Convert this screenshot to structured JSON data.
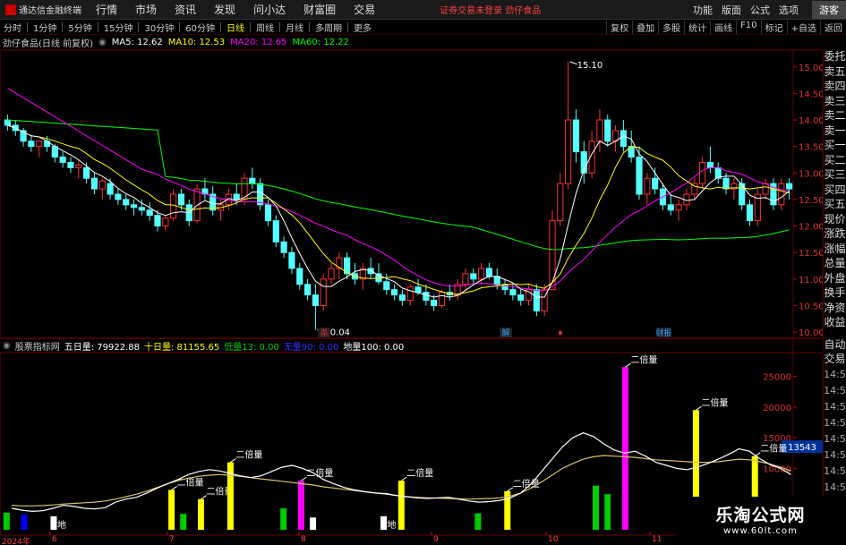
{
  "menubar": {
    "logo": "通达信金融终端",
    "items": [
      "行情",
      "市场",
      "资讯",
      "发现",
      "问小达",
      "财富圈",
      "交易"
    ],
    "alert": "证券交易未登录  劲仔食品",
    "right": [
      "功能",
      "版面",
      "公式",
      "选项"
    ],
    "guest": "游客"
  },
  "periodbar": {
    "items": [
      "分时",
      "1分钟",
      "5分钟",
      "15分钟",
      "30分钟",
      "60分钟",
      "日线",
      "周线",
      "月线",
      "多周期",
      "更多"
    ],
    "active": "日线",
    "tools": [
      "复权",
      "叠加",
      "多股",
      "统计",
      "画线",
      "F10",
      "标记",
      "+自选",
      "返回"
    ]
  },
  "infobar": {
    "stock": "劲仔食品(日线 前复权)",
    "ma5": "MA5: 12.62",
    "ma10": "MA10: 12.53",
    "ma20": "MA20: 12.65",
    "ma60": "MA60: 12.22",
    "colors": {
      "ma5": "#ffffff",
      "ma10": "#ffff00",
      "ma20": "#ff00ff",
      "ma60": "#00ff00"
    }
  },
  "annotations": {
    "high": "15.10",
    "low": "10.04",
    "double_vol": "二倍量",
    "low_vol_tag": "地"
  },
  "event_tags": [
    "杀",
    "解",
    "财报"
  ],
  "indbar": {
    "name": "股票指标网",
    "ma5": "五日量: 79922.88",
    "ma10": "十日量: 81155.65",
    "low": "低量13: 0.00",
    "zero": "无量90: 0.00",
    "ground": "地量100: 0.00"
  },
  "price_axis": [
    "15.00",
    "14.50",
    "14.00",
    "13.50",
    "13.00",
    "12.50",
    "12.00",
    "11.50",
    "11.00",
    "10.50",
    "10.00"
  ],
  "vol_axis": [
    "25000",
    "20000",
    "15000",
    "10000"
  ],
  "vol_current": "13543",
  "right_panel_top": [
    "委托",
    "卖五",
    "卖四",
    "卖三",
    "卖二",
    "卖一",
    "买一",
    "买二",
    "买三",
    "买四",
    "买五",
    "现价",
    "涨跌",
    "涨幅",
    "总量",
    "外盘",
    "换手",
    "净资",
    "收益"
  ],
  "right_panel_bottom": [
    "自动",
    "交易",
    "14:5",
    "14:5",
    "14:5",
    "14:5",
    "14:5",
    "14:5",
    "14:5",
    "14:5"
  ],
  "date_axis": [
    "2024年",
    "6",
    "7",
    "8",
    "9",
    "10",
    "11"
  ],
  "watermark": {
    "line1": "乐淘公式网",
    "line2": "www.60lt.com"
  },
  "chart_data": [
    {
      "type": "candlestick",
      "title": "劲仔食品(日线 前复权)",
      "ylim": [
        9.9,
        15.3
      ],
      "ohlc": [
        [
          14.0,
          14.1,
          13.8,
          13.9
        ],
        [
          13.9,
          14.0,
          13.7,
          13.8
        ],
        [
          13.8,
          13.85,
          13.5,
          13.6
        ],
        [
          13.6,
          13.7,
          13.4,
          13.5
        ],
        [
          13.5,
          13.6,
          13.3,
          13.6
        ],
        [
          13.6,
          13.7,
          13.4,
          13.5
        ],
        [
          13.5,
          13.55,
          13.2,
          13.3
        ],
        [
          13.3,
          13.4,
          13.1,
          13.2
        ],
        [
          13.2,
          13.3,
          13.0,
          13.1
        ],
        [
          13.1,
          13.25,
          12.9,
          13.15
        ],
        [
          13.1,
          13.2,
          12.8,
          12.9
        ],
        [
          12.9,
          13.0,
          12.6,
          12.7
        ],
        [
          12.7,
          12.9,
          12.5,
          12.85
        ],
        [
          12.8,
          12.9,
          12.5,
          12.6
        ],
        [
          12.6,
          12.7,
          12.4,
          12.5
        ],
        [
          12.5,
          12.6,
          12.3,
          12.4
        ],
        [
          12.4,
          12.5,
          12.2,
          12.35
        ],
        [
          12.35,
          12.5,
          12.2,
          12.3
        ],
        [
          12.3,
          12.45,
          12.1,
          12.2
        ],
        [
          12.2,
          12.3,
          11.9,
          12.0
        ],
        [
          12.0,
          12.2,
          11.9,
          12.15
        ],
        [
          12.15,
          12.7,
          12.1,
          12.6
        ],
        [
          12.6,
          12.7,
          12.3,
          12.4
        ],
        [
          12.4,
          12.5,
          12.0,
          12.1
        ],
        [
          12.1,
          12.8,
          12.05,
          12.7
        ],
        [
          12.7,
          12.9,
          12.5,
          12.6
        ],
        [
          12.6,
          12.75,
          12.2,
          12.3
        ],
        [
          12.3,
          12.5,
          12.1,
          12.4
        ],
        [
          12.4,
          12.7,
          12.3,
          12.6
        ],
        [
          12.6,
          12.8,
          12.4,
          12.5
        ],
        [
          12.5,
          13.0,
          12.4,
          12.9
        ],
        [
          12.9,
          13.1,
          12.7,
          12.8
        ],
        [
          12.8,
          12.9,
          12.3,
          12.4
        ],
        [
          12.4,
          12.5,
          12.0,
          12.1
        ],
        [
          12.1,
          12.2,
          11.6,
          11.7
        ],
        [
          11.7,
          11.8,
          11.4,
          11.5
        ],
        [
          11.5,
          11.6,
          11.1,
          11.2
        ],
        [
          11.2,
          11.3,
          10.8,
          10.9
        ],
        [
          10.9,
          11.0,
          10.6,
          10.7
        ],
        [
          10.7,
          10.9,
          10.04,
          10.5
        ],
        [
          10.5,
          11.1,
          10.4,
          11.0
        ],
        [
          11.0,
          11.3,
          10.9,
          11.2
        ],
        [
          11.2,
          11.5,
          11.0,
          11.4
        ],
        [
          11.4,
          11.5,
          11.0,
          11.1
        ],
        [
          11.1,
          11.3,
          10.9,
          11.0
        ],
        [
          11.0,
          11.3,
          10.8,
          11.2
        ],
        [
          11.2,
          11.4,
          11.0,
          11.1
        ],
        [
          11.1,
          11.3,
          10.9,
          10.95
        ],
        [
          10.95,
          11.1,
          10.7,
          10.8
        ],
        [
          10.8,
          10.9,
          10.6,
          10.7
        ],
        [
          10.7,
          10.8,
          10.5,
          10.6
        ],
        [
          10.6,
          10.9,
          10.5,
          10.85
        ],
        [
          10.85,
          11.0,
          10.7,
          10.75
        ],
        [
          10.75,
          10.9,
          10.5,
          10.6
        ],
        [
          10.6,
          10.7,
          10.4,
          10.5
        ],
        [
          10.5,
          10.8,
          10.45,
          10.75
        ],
        [
          10.75,
          10.9,
          10.6,
          10.7
        ],
        [
          10.7,
          11.0,
          10.6,
          10.9
        ],
        [
          10.9,
          11.2,
          10.8,
          11.1
        ],
        [
          11.1,
          11.2,
          10.9,
          11.0
        ],
        [
          11.0,
          11.3,
          10.9,
          11.2
        ],
        [
          11.2,
          11.3,
          11.0,
          11.05
        ],
        [
          11.05,
          11.2,
          10.8,
          10.9
        ],
        [
          10.9,
          11.0,
          10.7,
          10.8
        ],
        [
          10.8,
          10.9,
          10.6,
          10.7
        ],
        [
          10.7,
          10.8,
          10.5,
          10.6
        ],
        [
          10.6,
          10.9,
          10.5,
          10.8
        ],
        [
          10.8,
          10.9,
          10.3,
          10.4
        ],
        [
          10.4,
          10.9,
          10.3,
          10.8
        ],
        [
          10.8,
          12.3,
          10.8,
          12.1
        ],
        [
          12.1,
          13.0,
          12.0,
          12.8
        ],
        [
          12.8,
          15.1,
          12.7,
          14.0
        ],
        [
          14.0,
          14.2,
          13.2,
          13.4
        ],
        [
          13.4,
          13.6,
          12.8,
          13.0
        ],
        [
          13.0,
          13.8,
          12.9,
          13.6
        ],
        [
          13.6,
          14.2,
          13.4,
          14.0
        ],
        [
          14.0,
          14.1,
          13.5,
          13.6
        ],
        [
          13.6,
          13.9,
          13.4,
          13.8
        ],
        [
          13.8,
          14.0,
          13.4,
          13.5
        ],
        [
          13.5,
          13.8,
          13.2,
          13.3
        ],
        [
          13.3,
          13.5,
          12.5,
          12.6
        ],
        [
          12.6,
          13.0,
          12.4,
          12.9
        ],
        [
          12.9,
          13.1,
          12.6,
          12.7
        ],
        [
          12.7,
          12.8,
          12.3,
          12.4
        ],
        [
          12.4,
          12.6,
          12.2,
          12.3
        ],
        [
          12.3,
          12.5,
          12.1,
          12.4
        ],
        [
          12.4,
          12.7,
          12.3,
          12.6
        ],
        [
          12.6,
          12.9,
          12.5,
          12.8
        ],
        [
          12.8,
          13.3,
          12.7,
          13.2
        ],
        [
          13.2,
          13.5,
          13.0,
          13.1
        ],
        [
          13.1,
          13.2,
          12.8,
          12.9
        ],
        [
          12.9,
          13.0,
          12.6,
          12.7
        ],
        [
          12.7,
          12.9,
          12.5,
          12.8
        ],
        [
          12.8,
          12.9,
          12.3,
          12.4
        ],
        [
          12.4,
          12.5,
          12.0,
          12.1
        ],
        [
          12.1,
          12.7,
          12.0,
          12.6
        ],
        [
          12.6,
          12.9,
          12.5,
          12.8
        ],
        [
          12.8,
          12.9,
          12.3,
          12.4
        ],
        [
          12.4,
          12.9,
          12.3,
          12.8
        ],
        [
          12.8,
          12.9,
          12.5,
          12.7
        ]
      ],
      "series": [
        {
          "name": "MA5",
          "color": "#ffffff"
        },
        {
          "name": "MA10",
          "color": "#ffff00"
        },
        {
          "name": "MA20",
          "color": "#ff00ff"
        },
        {
          "name": "MA60",
          "color": "#00ff00"
        }
      ]
    },
    {
      "type": "bar",
      "title": "股票指标网",
      "ylim": [
        0,
        28000
      ],
      "vol_bars": [
        {
          "i": 0,
          "v": 2800,
          "c": "#00cc00"
        },
        {
          "i": 3,
          "v": 2500,
          "c": "#0000ff"
        },
        {
          "i": 8,
          "v": 2200,
          "c": "#ffffff",
          "lbl": "地"
        },
        {
          "i": 28,
          "v": 6500,
          "c": "#ffff00",
          "lbl": "二倍量"
        },
        {
          "i": 30,
          "v": 2600,
          "c": "#00cc00"
        },
        {
          "i": 33,
          "v": 5000,
          "c": "#ffff00",
          "lbl": "二倍量"
        },
        {
          "i": 38,
          "v": 11000,
          "c": "#ffff00",
          "lbl": "二倍量"
        },
        {
          "i": 47,
          "v": 3500,
          "c": "#00cc00"
        },
        {
          "i": 50,
          "v": 8000,
          "c": "#ff00ff",
          "lbl": "二倍量"
        },
        {
          "i": 52,
          "v": 2000,
          "c": "#ffffff"
        },
        {
          "i": 64,
          "v": 2200,
          "c": "#ffffff",
          "lbl": "地"
        },
        {
          "i": 67,
          "v": 8000,
          "c": "#ffff00",
          "lbl": "二倍量"
        },
        {
          "i": 80,
          "v": 2700,
          "c": "#00cc00"
        },
        {
          "i": 85,
          "v": 6300,
          "c": "#ffff00",
          "lbl": "二倍量"
        },
        {
          "i": 100,
          "v": 7200,
          "c": "#00cc00"
        },
        {
          "i": 102,
          "v": 5800,
          "c": "#00cc00"
        },
        {
          "i": 105,
          "v": 26500,
          "c": "#ff00ff",
          "lbl": "二倍量"
        },
        {
          "i": 117,
          "v": 19500,
          "c": "#ffff00",
          "lbl": "二倍量"
        },
        {
          "i": 121,
          "v": 3000,
          "c": "#00cc00"
        },
        {
          "i": 127,
          "v": 12000,
          "c": "#ffff00",
          "lbl": "二倍量"
        },
        {
          "i": 131,
          "v": 3200,
          "c": "#00cc00"
        }
      ],
      "vol_ma5": [
        3500,
        3200,
        3000,
        3100,
        3500,
        4000,
        3800,
        3500,
        3400,
        3600,
        4500,
        5000,
        5300,
        6000,
        6800,
        7500,
        8200,
        9000,
        9500,
        9800,
        9600,
        9200,
        8800,
        8500,
        8800,
        9500,
        10200,
        10500,
        10000,
        9300,
        8200,
        7500,
        6900,
        6500,
        6200,
        6000,
        5900,
        5600,
        5400,
        5200,
        5100,
        5200,
        5300,
        5000,
        4700,
        4500,
        4600,
        4800,
        5200,
        6000,
        7500,
        9500,
        11500,
        13500,
        15000,
        15800,
        15200,
        14000,
        13000,
        12500,
        12800,
        12000,
        11000,
        10500,
        10000,
        9800,
        10200,
        10800,
        11500,
        12300,
        13200,
        12800,
        11600,
        10600,
        10000,
        9000
      ],
      "vol_ma10": [
        4000,
        3900,
        3900,
        3950,
        4050,
        4200,
        4300,
        4400,
        4500,
        4700,
        5000,
        5400,
        5800,
        6300,
        6900,
        7500,
        8000,
        8400,
        8700,
        8900,
        9000,
        8900,
        8700,
        8500,
        8300,
        8100,
        7900,
        7700,
        7500,
        7300,
        7000,
        6800,
        6600,
        6400,
        6200,
        6000,
        5800,
        5600,
        5400,
        5300,
        5200,
        5150,
        5100,
        5050,
        5000,
        5050,
        5100,
        5200,
        5500,
        6000,
        6800,
        7800,
        8900,
        10000,
        10800,
        11500,
        11900,
        12100,
        12000,
        11900,
        11800,
        11600,
        11400,
        11300,
        11200,
        11100,
        11000,
        11000,
        11100,
        11300,
        11500,
        11400,
        11100,
        10700,
        10200,
        9600
      ]
    }
  ]
}
